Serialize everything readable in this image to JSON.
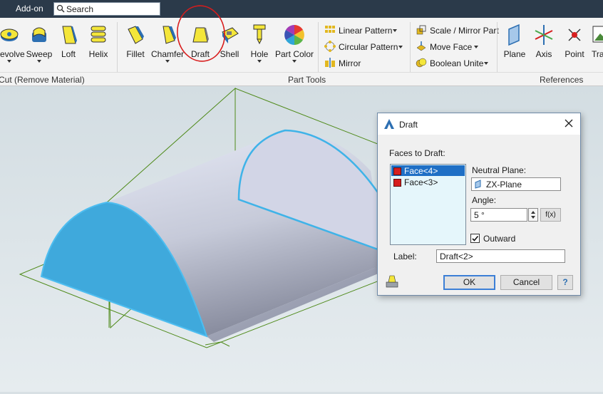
{
  "topbar": {
    "tab_label": "Add-on",
    "search_placeholder": "Search"
  },
  "ribbon": {
    "sketch_tools": [
      {
        "label": "Revolve",
        "name": "revolve"
      },
      {
        "label": "Sweep",
        "name": "sweep"
      },
      {
        "label": "Loft",
        "name": "loft"
      },
      {
        "label": "Helix",
        "name": "helix"
      }
    ],
    "part_tools": [
      {
        "label": "Fillet"
      },
      {
        "label": "Chamfer"
      },
      {
        "label": "Draft"
      },
      {
        "label": "Shell"
      },
      {
        "label": "Hole"
      },
      {
        "label": "Part Color"
      }
    ],
    "pattern_tools": {
      "linear": "Linear Pattern",
      "circular": "Circular Pattern",
      "mirror": "Mirror"
    },
    "part_edit_tools": {
      "scale": "Scale / Mirror Part",
      "move_face": "Move Face",
      "boolean": "Boolean Unite"
    },
    "references": [
      {
        "label": "Plane"
      },
      {
        "label": "Axis"
      },
      {
        "label": "Point"
      },
      {
        "label": "Tra Ima"
      }
    ],
    "group_labels": {
      "cut": "Cut (Remove Material)",
      "part_tools": "Part Tools",
      "references": "References"
    }
  },
  "dialog": {
    "title": "Draft",
    "faces_label": "Faces to Draft:",
    "faces": [
      "Face<4>",
      "Face<3>"
    ],
    "neutral_plane_label": "Neutral Plane:",
    "neutral_plane_value": "ZX-Plane",
    "angle_label": "Angle:",
    "angle_value": "5 °",
    "fx_label": "f(x)",
    "outward_label": "Outward",
    "outward_checked": true,
    "label_label": "Label:",
    "label_value": "Draft<2>",
    "ok_label": "OK",
    "cancel_label": "Cancel",
    "help_label": "?"
  },
  "colors": {
    "face_highlight": "#3fa9dc",
    "ribbon_bg": "#f3f3f3",
    "topbar_bg": "#2b3a4a",
    "annotation_circle": "#d81c1c"
  }
}
